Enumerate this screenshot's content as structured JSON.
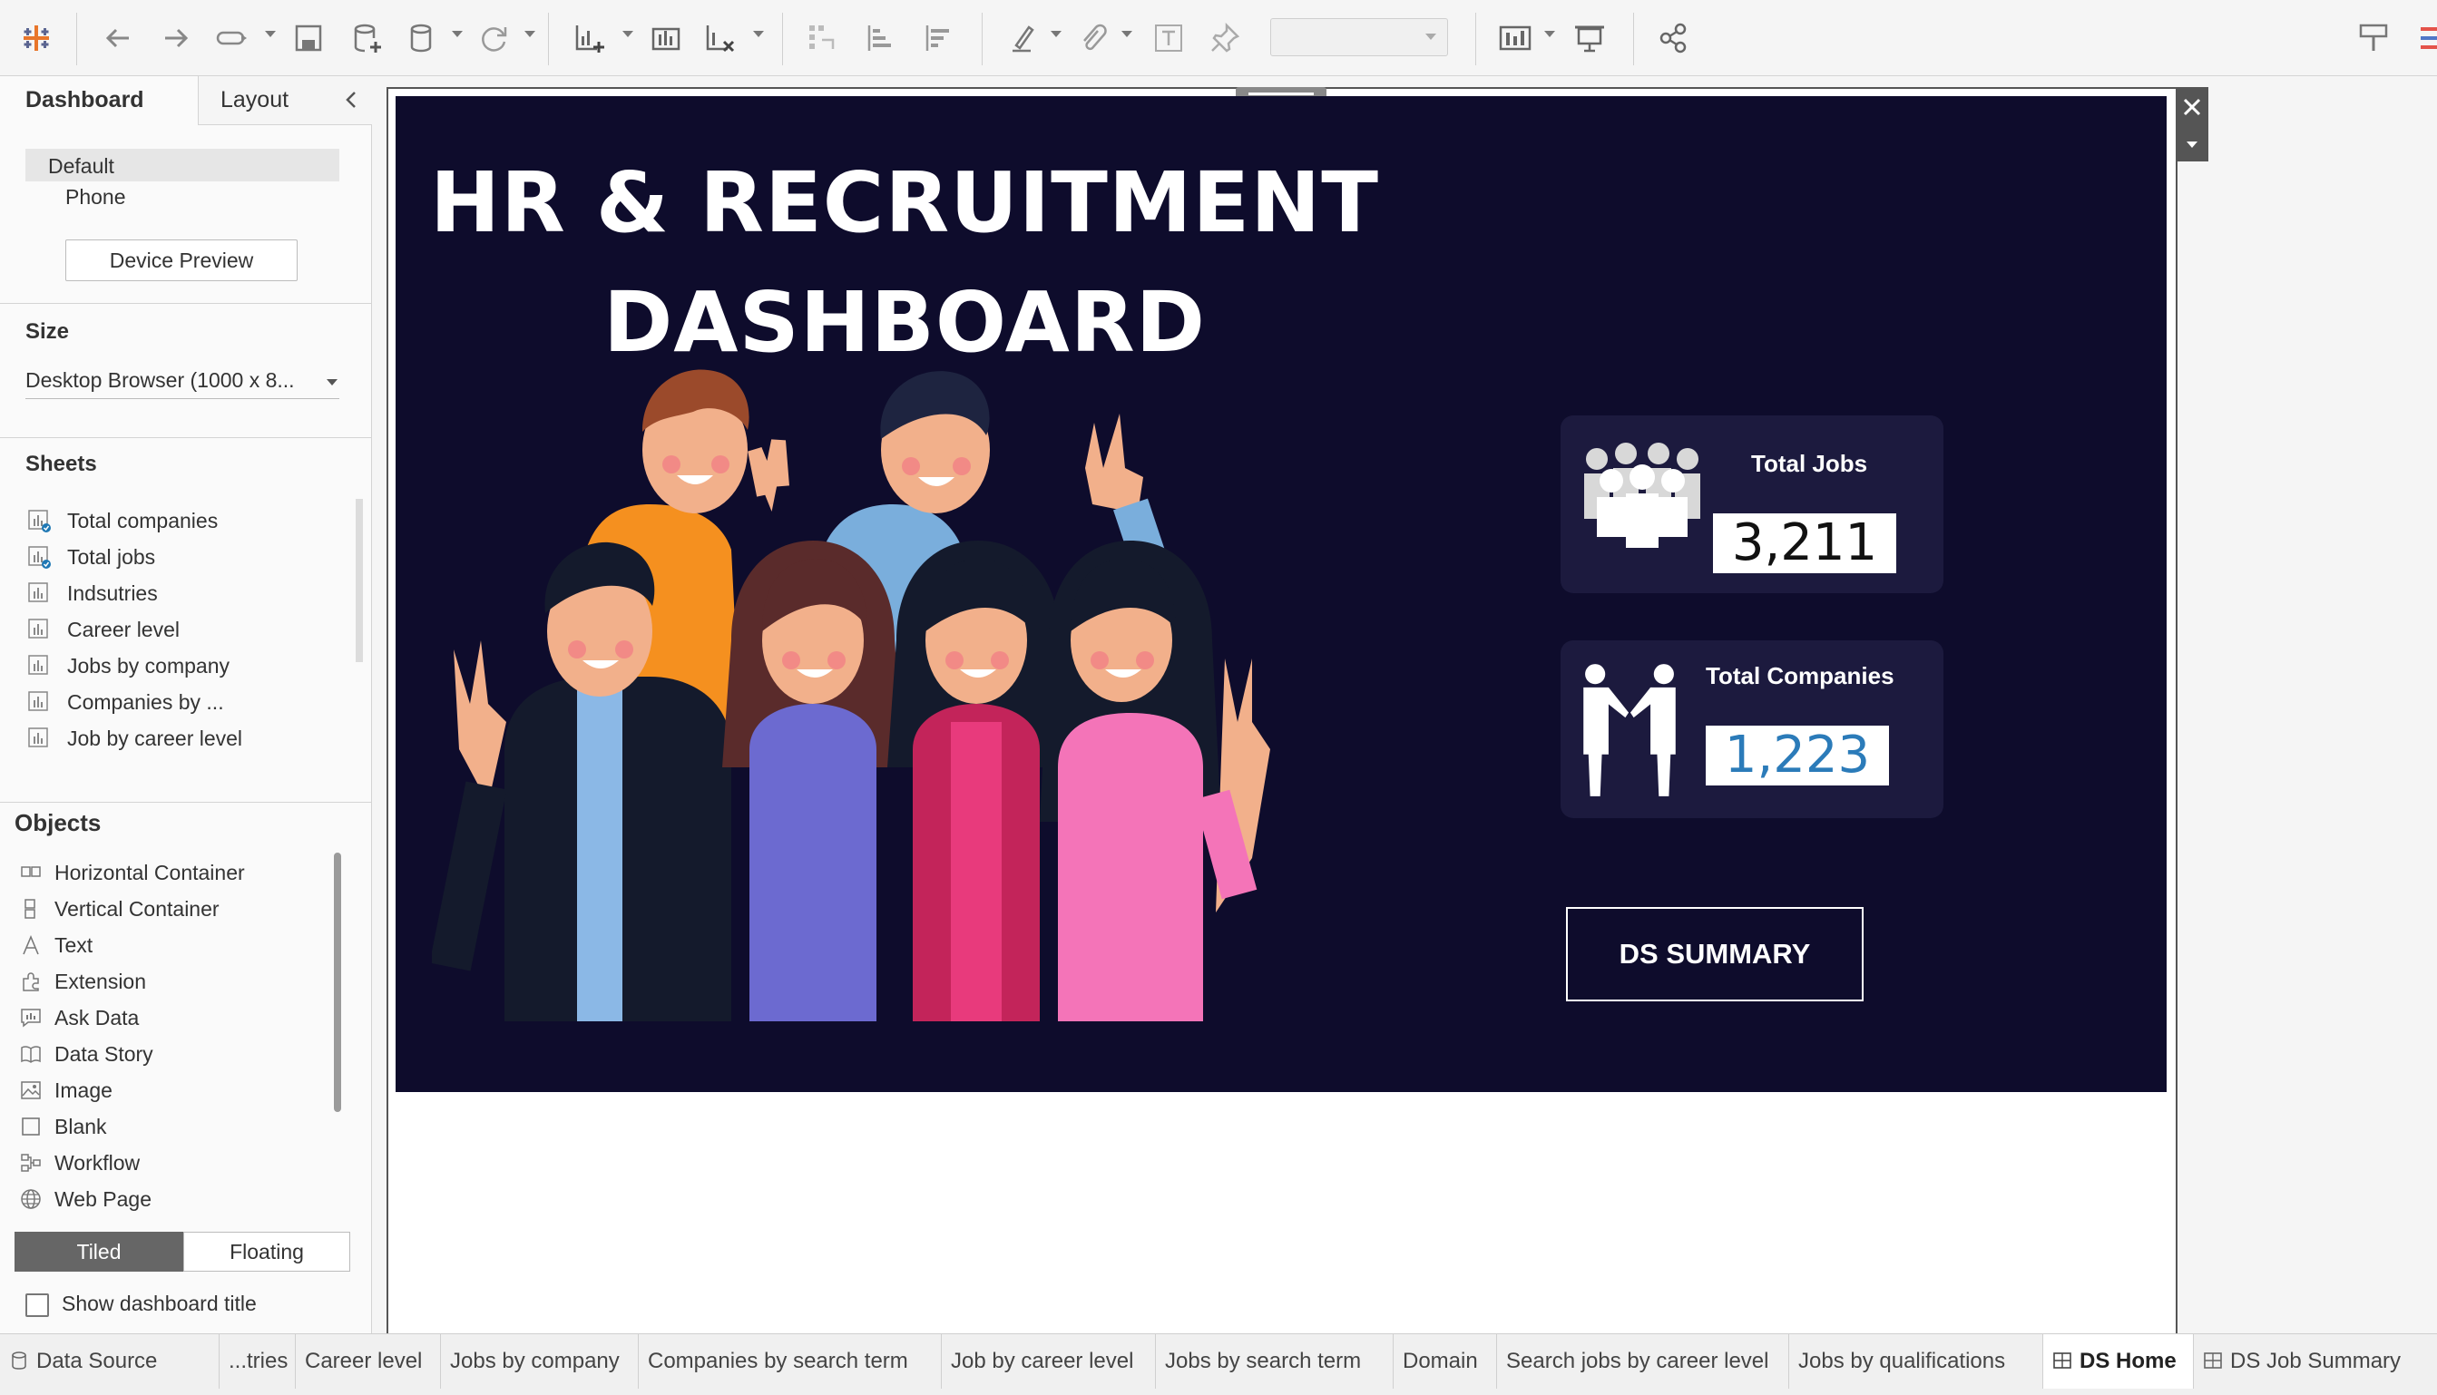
{
  "left_panel": {
    "tabs": {
      "dashboard": "Dashboard",
      "layout": "Layout"
    },
    "device": {
      "default": "Default",
      "phone": "Phone",
      "preview_button": "Device Preview"
    },
    "size": {
      "title": "Size",
      "value": "Desktop Browser (1000 x 8..."
    },
    "sheets": {
      "title": "Sheets",
      "items": [
        "Total companies",
        "Total jobs",
        "Indsutries",
        "Career level",
        "Jobs by company",
        "Companies by ...",
        "Job by career level"
      ]
    },
    "objects": {
      "title": "Objects",
      "items": [
        "Horizontal Container",
        "Vertical Container",
        "Text",
        "Extension",
        "Ask Data",
        "Data Story",
        "Image",
        "Blank",
        "Workflow",
        "Web Page"
      ]
    },
    "layout_mode": {
      "tiled": "Tiled",
      "floating": "Floating"
    },
    "show_title": {
      "label": "Show dashboard title",
      "checked": false
    }
  },
  "dashboard": {
    "title_line1": "HR & RECRUITMENT",
    "title_line2": "DASHBOARD",
    "total_jobs": {
      "label": "Total Jobs",
      "value": "3,211"
    },
    "total_companies": {
      "label": "Total Companies",
      "value": "1,223"
    },
    "summary_button": "DS SUMMARY",
    "colors": {
      "background": "#0e0c2c",
      "card": "#1c1a3e",
      "companies_value": "#2b7bb9"
    }
  },
  "sheet_tabs": {
    "data_source": "Data Source",
    "items": [
      "...tries",
      "Career level",
      "Jobs by company",
      "Companies by search term",
      "Job by career level",
      "Jobs by search term",
      "Domain",
      "Search jobs by career level",
      "Jobs by qualifications",
      "DS Home",
      "DS Job Summary"
    ],
    "active": "DS Home"
  },
  "icons": [
    "tableau-logo-icon",
    "back-icon",
    "forward-icon",
    "redo-icon",
    "save-icon",
    "new-datasource-icon",
    "datasource-icon",
    "refresh-icon",
    "new-worksheet-icon",
    "duplicate-icon",
    "clear-icon",
    "swap-icon",
    "sort-asc-icon",
    "sort-desc-icon",
    "highlight-icon",
    "annotate-icon",
    "textbox-icon",
    "pin-icon",
    "show-me-icon",
    "presentation-icon",
    "share-icon",
    "format-icon"
  ]
}
